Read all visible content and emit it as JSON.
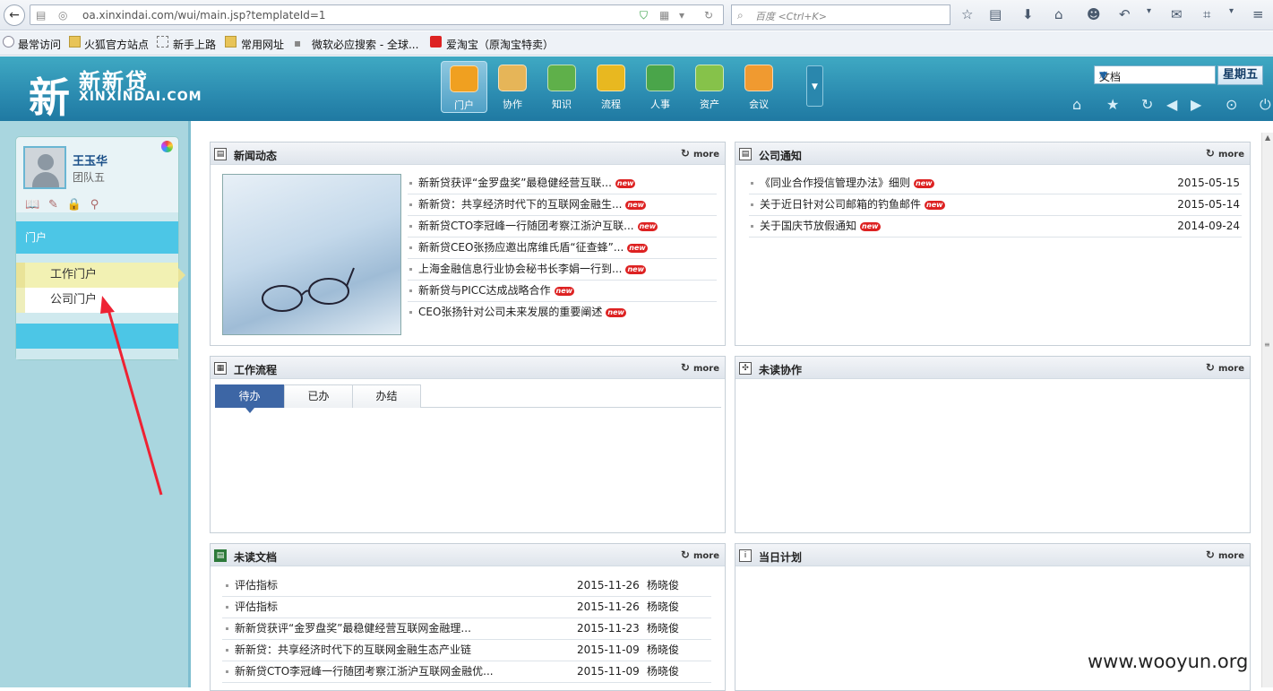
{
  "browser": {
    "url": "oa.xinxindai.com/wui/main.jsp?templateId=1",
    "search_placeholder": "百度 <Ctrl+K>"
  },
  "bookmarks": [
    {
      "label": "最常访问",
      "icon": "gear-icon"
    },
    {
      "label": "火狐官方站点",
      "icon": "folder-icon"
    },
    {
      "label": "新手上路",
      "icon": "page-icon"
    },
    {
      "label": "常用网址",
      "icon": "folder-icon"
    },
    {
      "label": "微软必应搜索 - 全球...",
      "icon": "bing-icon"
    },
    {
      "label": "爱淘宝（原淘宝特卖）",
      "icon": "taobao-icon"
    }
  ],
  "header": {
    "logo_mark": "新",
    "logo_cn": "新新贷",
    "logo_en": "XINXINDAI.COM",
    "nav": [
      {
        "label": "门户",
        "color": "#f0a020",
        "active": true
      },
      {
        "label": "协作",
        "color": "#e6b558"
      },
      {
        "label": "知识",
        "color": "#5fb04a"
      },
      {
        "label": "流程",
        "color": "#e8b820"
      },
      {
        "label": "人事",
        "color": "#4aa54a"
      },
      {
        "label": "资产",
        "color": "#86c24a"
      },
      {
        "label": "会议",
        "color": "#f09a30"
      }
    ],
    "search_type": "文档",
    "weekday": "星期五"
  },
  "sidebar": {
    "user_name": "王玉华",
    "user_team": "团队五",
    "menu_title": "门户",
    "submenu": [
      "工作门户",
      "公司门户"
    ]
  },
  "portlets": {
    "more_label": "more",
    "news": {
      "title": "新闻动态",
      "items": [
        "新新贷获评“金罗盘奖”最稳健经营互联...",
        "新新贷：共享经济时代下的互联网金融生...",
        "新新贷CTO李冠峰一行随团考察江浙沪互联...",
        "新新贷CEO张扬应邀出席维氏盾“征查蜂”...",
        "上海金融信息行业协会秘书长李娟一行到...",
        "新新贷与PICC达成战略合作",
        "CEO张扬针对公司未来发展的重要阐述"
      ],
      "new_tag": "new"
    },
    "notice": {
      "title": "公司通知",
      "items": [
        {
          "text": "《同业合作授信管理办法》细则",
          "date": "2015-05-15"
        },
        {
          "text": "关于近日针对公司邮箱的钓鱼邮件",
          "date": "2015-05-14"
        },
        {
          "text": "关于国庆节放假通知",
          "date": "2014-09-24"
        }
      ]
    },
    "workflow": {
      "title": "工作流程",
      "tabs": [
        "待办",
        "已办",
        "办结"
      ]
    },
    "collab": {
      "title": "未读协作"
    },
    "docs": {
      "title": "未读文档",
      "items": [
        {
          "text": "评估指标",
          "date": "2015-11-26",
          "author": "杨晓俊"
        },
        {
          "text": "评估指标",
          "date": "2015-11-26",
          "author": "杨晓俊"
        },
        {
          "text": "新新贷获评“金罗盘奖”最稳健经营互联网金融理...",
          "date": "2015-11-23",
          "author": "杨晓俊"
        },
        {
          "text": "新新贷：共享经济时代下的互联网金融生态产业链",
          "date": "2015-11-09",
          "author": "杨晓俊"
        },
        {
          "text": "新新贷CTO李冠峰一行随团考察江浙沪互联网金融优...",
          "date": "2015-11-09",
          "author": "杨晓俊"
        }
      ]
    },
    "plan": {
      "title": "当日计划"
    }
  },
  "watermark": "www.wooyun.org"
}
